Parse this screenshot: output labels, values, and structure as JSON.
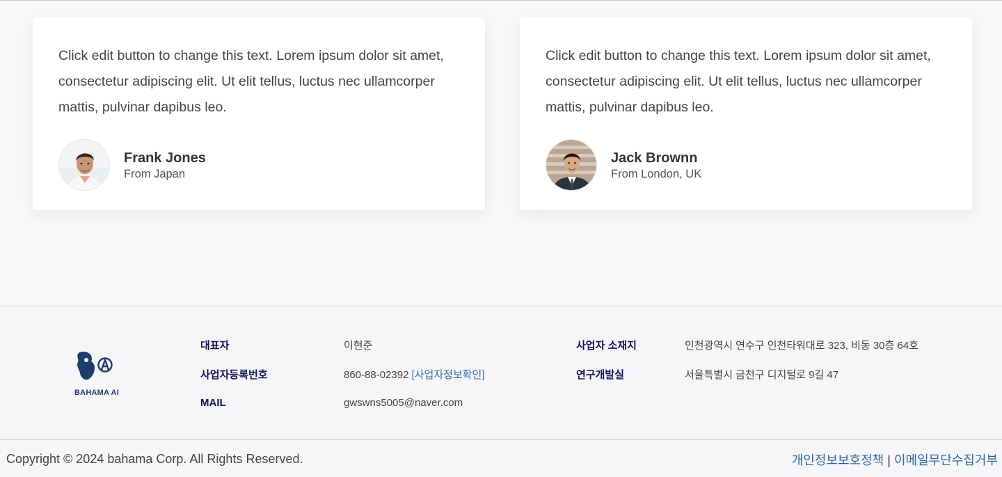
{
  "testimonials": [
    {
      "quote": "Click edit button to change this text. Lorem ipsum dolor sit amet, consectetur adipiscing elit. Ut elit tellus, luctus nec ullamcorper mattis, pulvinar dapibus leo.",
      "name": "Frank Jones",
      "from": "From Japan"
    },
    {
      "quote": "Click edit button to change this text. Lorem ipsum dolor sit amet, consectetur adipiscing elit. Ut elit tellus, luctus nec ullamcorper mattis, pulvinar dapibus leo.",
      "name": "Jack Brownn",
      "from": "From London, UK"
    }
  ],
  "footer": {
    "logo_text": "BAHAMA AI",
    "representative_label": "대표자",
    "representative_value": "이현준",
    "business_number_label": "사업자등록번호",
    "business_number_value": "860-88-02392",
    "business_check_link": "[사업자정보확인]",
    "mail_label": "MAIL",
    "mail_value": "gwswns5005@naver.com",
    "address_label": "사업자 소재지",
    "address_value": "인천광역시 연수구 인천타워대로 323, 비동 30층 64호",
    "lab_label": "연구개발실",
    "lab_value": "서울특별시 금천구 디지털로 9길 47",
    "copyright": "Copyright © 2024 bahama Corp. All Rights Reserved.",
    "privacy_link": "개인정보보호정책",
    "separator": "|",
    "email_refusal_link": "이메일무단수집거부"
  },
  "colors": {
    "page_bg": "#f9f8f9",
    "footer_label": "#12125a",
    "link": "#2e6aa8",
    "logo": "#1d3b6b"
  }
}
